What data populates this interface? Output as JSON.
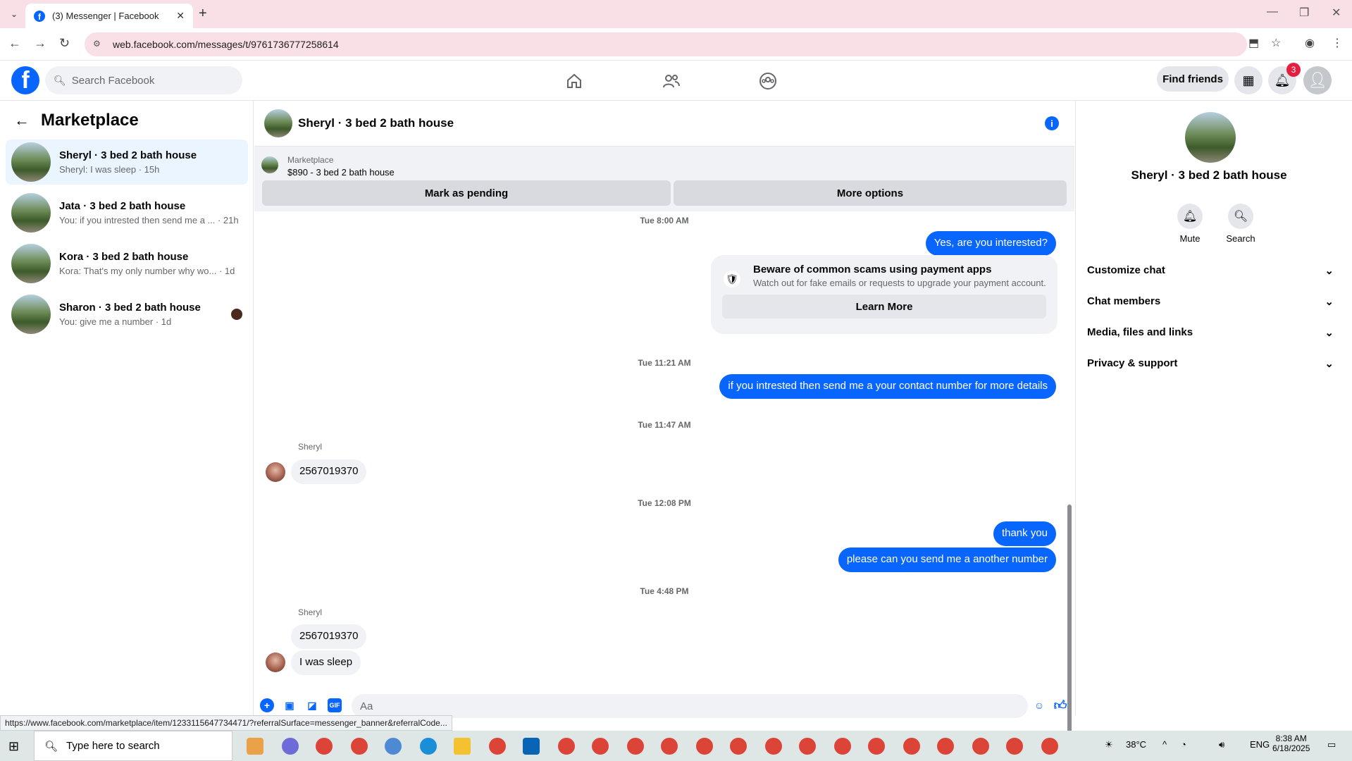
{
  "browser": {
    "tab_title": "(3) Messenger | Facebook",
    "url": "web.facebook.com/messages/t/9761736777258614",
    "status_url": "https://www.facebook.com/marketplace/item/1233115647734471/?referralSurface=messenger_banner&referralCode..."
  },
  "header": {
    "search_placeholder": "Search Facebook",
    "find_friends": "Find friends",
    "notification_count": "3"
  },
  "sidebar": {
    "title": "Marketplace",
    "conversations": [
      {
        "name": "Sheryl · 3 bed 2 bath house",
        "preview": "Sheryl: I was sleep · 15h",
        "active": true
      },
      {
        "name": "Jata · 3 bed 2 bath house",
        "preview": "You: if you intrested then send me a ... · 21h"
      },
      {
        "name": "Kora · 3 bed 2 bath house",
        "preview": "Kora: That's my only number why wo... · 1d"
      },
      {
        "name": "Sharon · 3 bed 2 bath house",
        "preview": "You: give me a number · 1d"
      }
    ]
  },
  "chat": {
    "title": "Sheryl · 3 bed 2 bath house",
    "listing": {
      "category": "Marketplace",
      "item": "$890 - 3 bed 2 bath house",
      "mark_pending": "Mark as pending",
      "more_options": "More options"
    },
    "messages": {
      "ts1": "Tue 8:00 AM",
      "m1": "Yes, are you interested?",
      "scam_title": "Beware of common scams using payment apps",
      "scam_sub": "Watch out for fake emails or requests to upgrade your payment account.",
      "learn_more": "Learn More",
      "ts2": "Tue 11:21 AM",
      "m2": "if you intrested then send me a your contact number for more details",
      "ts3": "Tue 11:47 AM",
      "sender1": "Sheryl",
      "m3": "2567019370",
      "ts4": "Tue 12:08 PM",
      "m4": "thank you",
      "m5": "please can you send me a another number",
      "ts5": "Tue 4:48 PM",
      "sender2": "Sheryl",
      "m6": "2567019370",
      "m7": "I was sleep"
    },
    "composer_placeholder": "Aa"
  },
  "right_panel": {
    "name": "Sheryl · 3 bed 2 bath house",
    "mute": "Mute",
    "search": "Search",
    "sections": [
      "Customize chat",
      "Chat members",
      "Media, files and links",
      "Privacy & support"
    ]
  },
  "taskbar": {
    "search_placeholder": "Type here to search",
    "weather": "38°C",
    "lang": "ENG",
    "time": "8:38 AM",
    "date": "6/18/2025"
  }
}
